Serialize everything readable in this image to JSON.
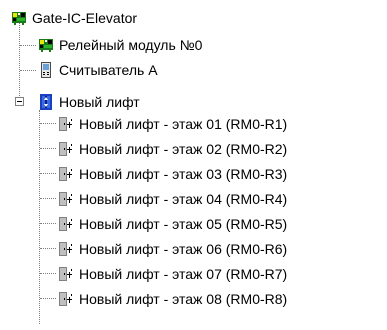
{
  "tree": {
    "root": {
      "label": "Gate-IC-Elevator",
      "icon": "controller-board-icon",
      "expanded": true
    },
    "children": [
      {
        "label": "Релейный модуль №0",
        "icon": "relay-module-icon"
      },
      {
        "label": "Считыватель А",
        "icon": "card-reader-icon"
      },
      {
        "label": "Новый лифт",
        "icon": "elevator-icon",
        "expanded": true
      }
    ],
    "floors": [
      {
        "label": "Новый лифт - этаж 01 (RM0-R1)",
        "icon": "door-floor-icon"
      },
      {
        "label": "Новый лифт - этаж 02 (RM0-R2)",
        "icon": "door-floor-icon"
      },
      {
        "label": "Новый лифт - этаж 03 (RM0-R3)",
        "icon": "door-floor-icon"
      },
      {
        "label": "Новый лифт - этаж 04 (RM0-R4)",
        "icon": "door-floor-icon"
      },
      {
        "label": "Новый лифт - этаж 05 (RM0-R5)",
        "icon": "door-floor-icon"
      },
      {
        "label": "Новый лифт - этаж 06 (RM0-R6)",
        "icon": "door-floor-icon"
      },
      {
        "label": "Новый лифт - этаж 07 (RM0-R7)",
        "icon": "door-floor-icon"
      },
      {
        "label": "Новый лифт - этаж 08 (RM0-R8)",
        "icon": "door-floor-icon"
      }
    ]
  }
}
